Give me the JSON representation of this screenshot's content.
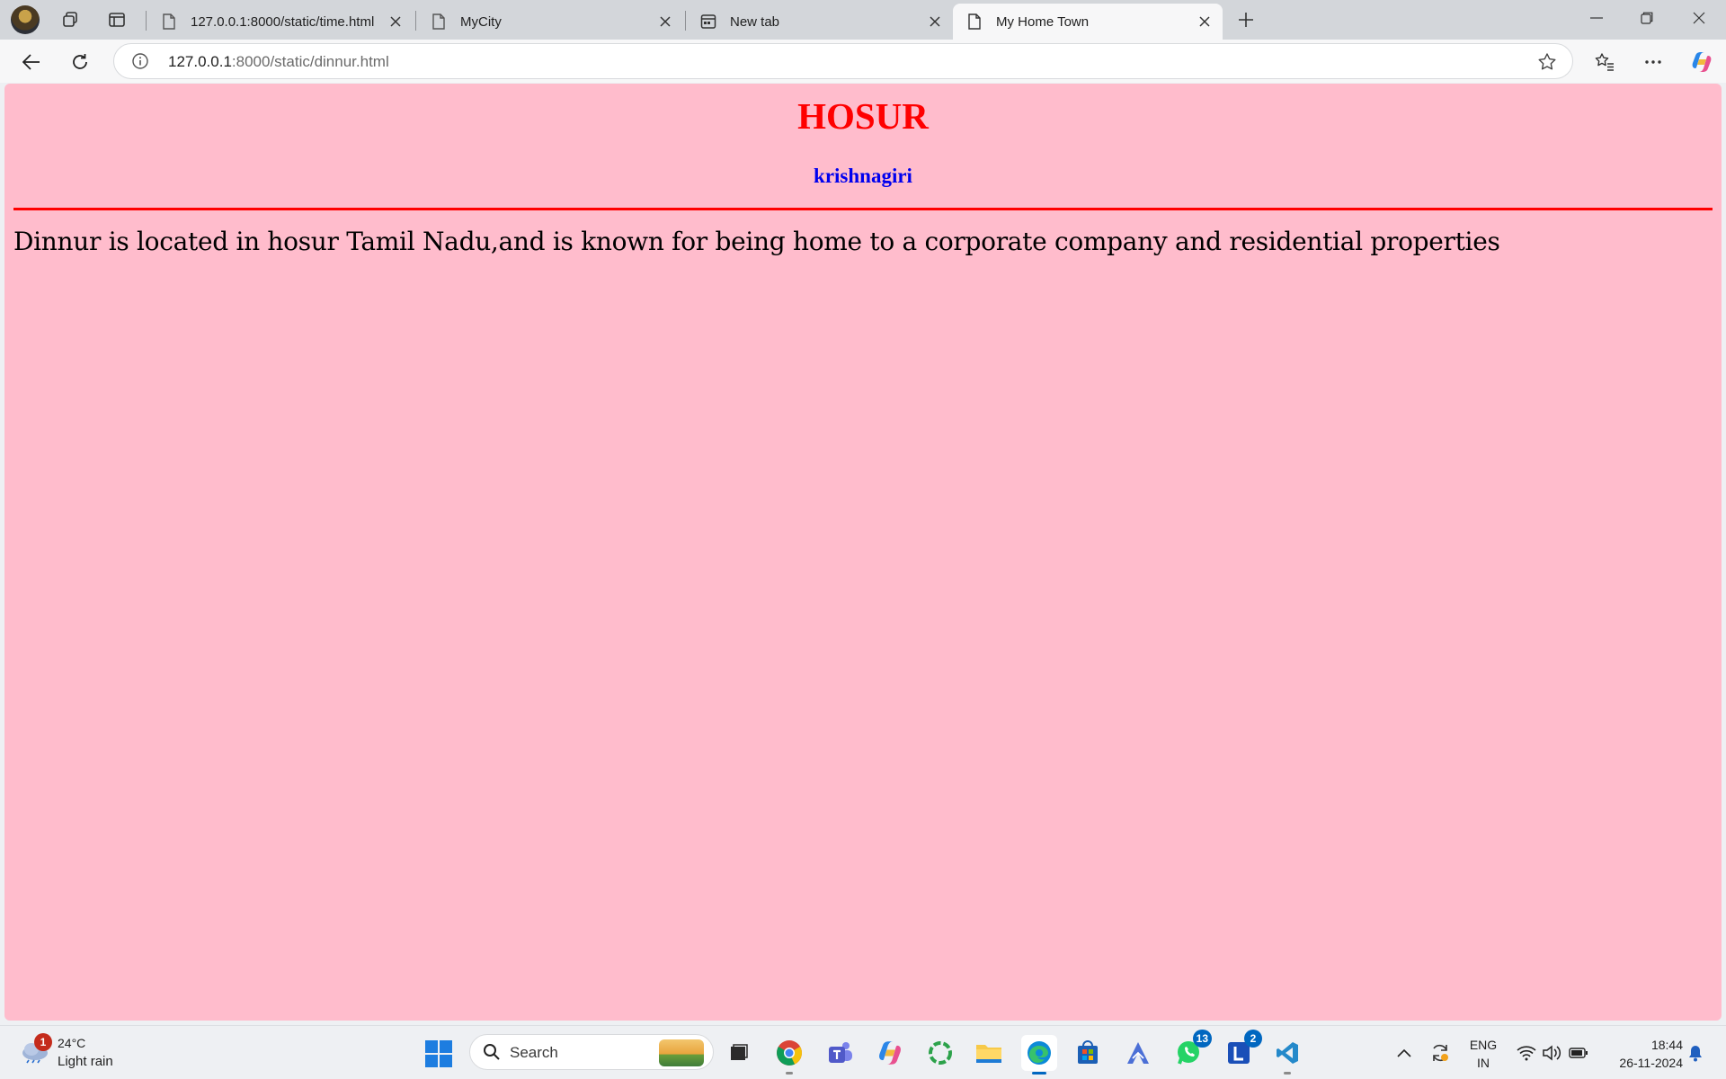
{
  "browser": {
    "tabs": [
      {
        "label": "127.0.0.1:8000/static/time.html",
        "icon": "page-icon"
      },
      {
        "label": "MyCity",
        "icon": "page-icon"
      },
      {
        "label": "New tab",
        "icon": "newtab-icon"
      },
      {
        "label": "My Home Town",
        "icon": "page-icon",
        "active": true
      }
    ],
    "address": {
      "host": "127.0.0.1",
      "path": ":8000/static/dinnur.html"
    }
  },
  "page": {
    "heading": "HOSUR",
    "subheading": "krishnagiri",
    "paragraph": "Dinnur is located in hosur Tamil Nadu,and is known for being home to a corporate company and residential properties",
    "background": "#ffbccc",
    "heading_color": "#ff0000",
    "subheading_color": "#0000ee",
    "rule_color": "#ff0000"
  },
  "taskbar": {
    "weather": {
      "temp": "24°C",
      "desc": "Light rain",
      "badge": "1"
    },
    "search_placeholder": "Search",
    "badges": {
      "whatsapp": "13",
      "lenovo": "2"
    },
    "language": {
      "line1": "ENG",
      "line2": "IN"
    },
    "clock": {
      "time": "18:44",
      "date": "26-11-2024"
    }
  }
}
